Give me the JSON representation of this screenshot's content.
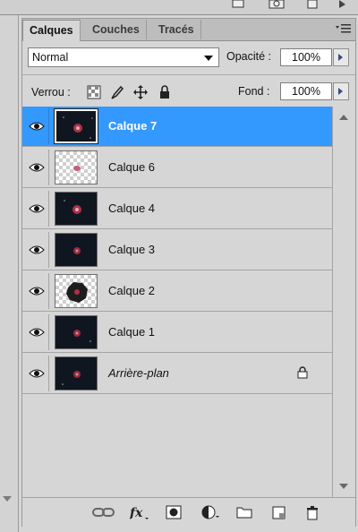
{
  "tabs": [
    {
      "label": "Calques",
      "active": true
    },
    {
      "label": "Couches",
      "active": false
    },
    {
      "label": "Tracés",
      "active": false
    }
  ],
  "blend_mode": {
    "value": "Normal"
  },
  "opacity": {
    "label": "Opacité :",
    "value": "100%"
  },
  "lock": {
    "label": "Verrou :",
    "icons": [
      "lock-transparency-icon",
      "lock-image-icon",
      "lock-position-icon",
      "lock-all-icon"
    ]
  },
  "fill": {
    "label": "Fond :",
    "value": "100%"
  },
  "layers": [
    {
      "name": "Calque 7",
      "selected": true,
      "visible": true,
      "thumb": "dark"
    },
    {
      "name": "Calque 6",
      "selected": false,
      "visible": true,
      "thumb": "checker-small"
    },
    {
      "name": "Calque 4",
      "selected": false,
      "visible": true,
      "thumb": "dark"
    },
    {
      "name": "Calque 3",
      "selected": false,
      "visible": true,
      "thumb": "dark"
    },
    {
      "name": "Calque 2",
      "selected": false,
      "visible": true,
      "thumb": "checker-blob"
    },
    {
      "name": "Calque 1",
      "selected": false,
      "visible": true,
      "thumb": "dark"
    },
    {
      "name": "Arrière-plan",
      "selected": false,
      "visible": true,
      "thumb": "dark",
      "italic": true,
      "locked": true
    }
  ],
  "colors": {
    "selection": "#3399ff",
    "panel": "#d6d6d6"
  },
  "bottom_icons": [
    "link-layers-icon",
    "fx-icon",
    "layer-mask-icon",
    "adjustment-layer-icon",
    "new-group-icon",
    "new-layer-icon",
    "trash-icon"
  ]
}
